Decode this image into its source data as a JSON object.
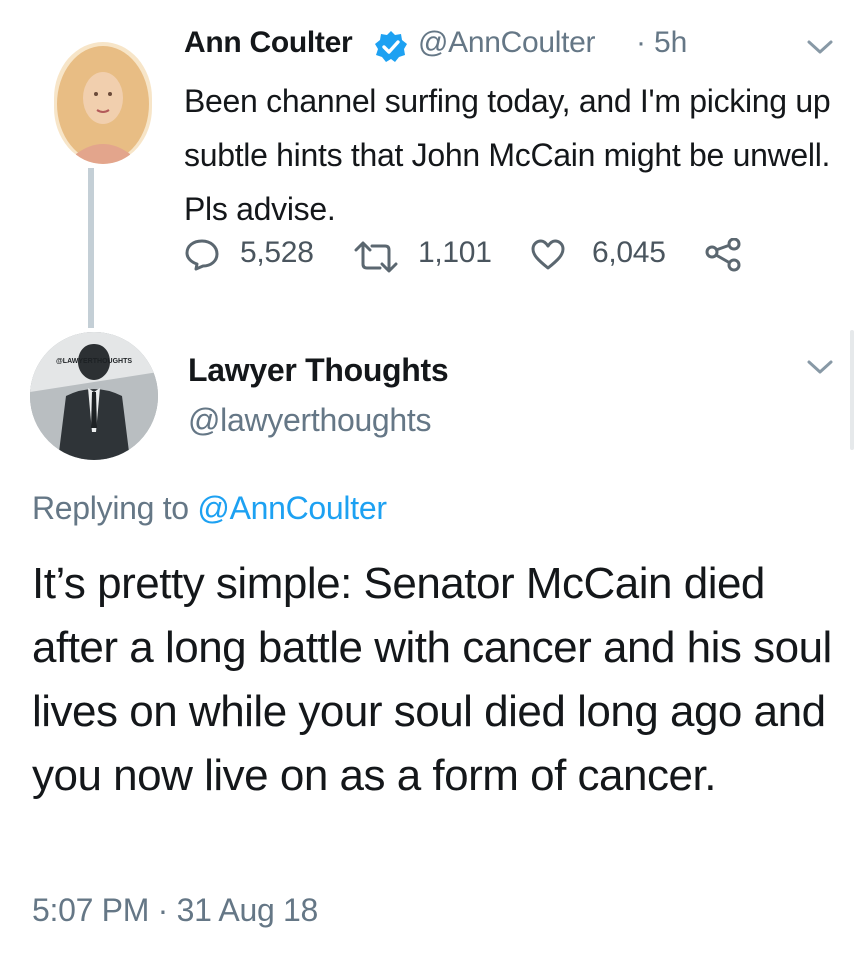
{
  "tweet1": {
    "author_name": "Ann Coulter",
    "handle": "@AnnCoulter",
    "separator": "·",
    "time_ago": "5h",
    "verified": true,
    "text": "Been channel surfing today, and I'm picking up subtle hints that John McCain might be unwell. Pls advise.",
    "actions": {
      "reply_count": "5,528",
      "retweet_count": "1,101",
      "like_count": "6,045"
    },
    "icons": [
      "reply-icon",
      "retweet-icon",
      "like-icon",
      "share-icon",
      "chevron-down-icon",
      "verified-badge-icon"
    ]
  },
  "tweet2": {
    "author_name": "Lawyer Thoughts",
    "handle": "@lawyerthoughts",
    "avatar_text": "@LAWYERTHOUGHTS",
    "replying_prefix": "Replying to",
    "replying_to": "@AnnCoulter",
    "text": "It’s pretty simple: Senator McCain died after a long battle with cancer and his soul lives on while your soul died long ago and you now live on as a form of cancer.",
    "timestamp": "5:07 PM · 31 Aug 18"
  },
  "colors": {
    "link": "#1da1f2",
    "secondary_text": "#657786",
    "primary_text": "#14171a",
    "thread_line": "#c4cfd6",
    "verified": "#1da1f2"
  }
}
